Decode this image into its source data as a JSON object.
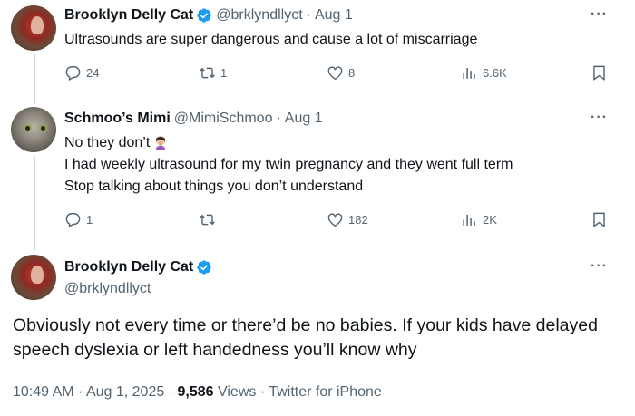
{
  "tweets": [
    {
      "name": "Brooklyn Delly Cat",
      "handle": "@brklyndllyct",
      "sep": "·",
      "date": "Aug 1",
      "text": "Ultrasounds are super dangerous and cause a lot of miscarriage",
      "replies": "24",
      "retweets": "1",
      "likes": "8",
      "views": "6.6K"
    },
    {
      "name": "Schmoo’s Mimi",
      "handle": "@MimiSchmoo",
      "sep": "·",
      "date": "Aug 1",
      "lines": [
        "No they don’t",
        "I had weekly ultrasound for my twin pregnancy and they went full term",
        "Stop talking about things you don’t understand"
      ],
      "replies": "1",
      "likes": "182",
      "views": "2K"
    }
  ],
  "main": {
    "name": "Brooklyn Delly Cat",
    "handle": "@brklyndllyct",
    "text": "Obviously not every time or there’d be no babies. If your kids have delayed speech dyslexia or left handedness you’ll know why",
    "time": "10:49 AM",
    "date": "Aug 1, 2025",
    "views_count": "9,586",
    "views_label": "Views",
    "client": "Twitter for iPhone",
    "dot": "·"
  },
  "more_label": "···",
  "colors": {
    "verified": "#1d9bf0",
    "muted": "#536471",
    "line": "#cfd9de"
  },
  "icons": [
    "reply-icon",
    "retweet-icon",
    "like-icon",
    "views-icon",
    "bookmark-icon",
    "verified-badge-icon",
    "more-icon"
  ]
}
